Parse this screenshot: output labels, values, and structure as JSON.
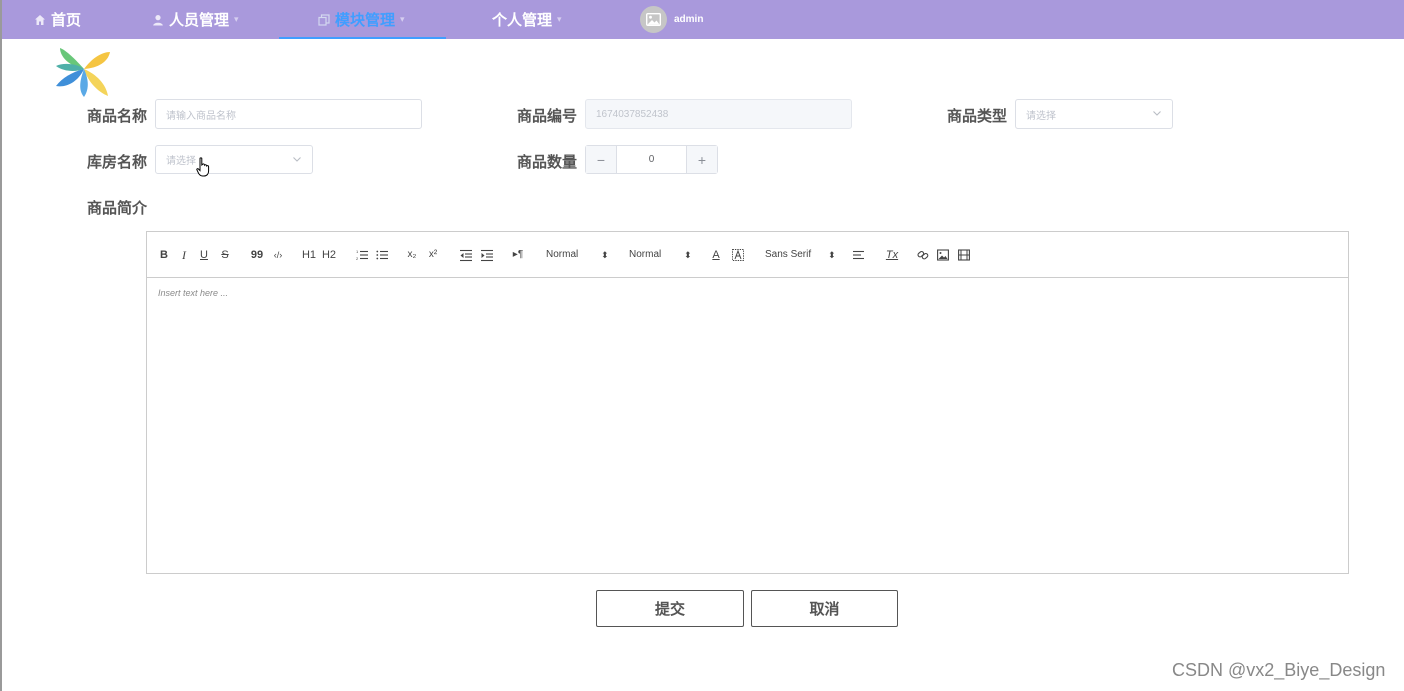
{
  "nav": {
    "items": [
      {
        "label": "首页",
        "icon": "home-icon"
      },
      {
        "label": "人员管理",
        "icon": "user-icon"
      },
      {
        "label": "模块管理",
        "icon": "copy-icon",
        "active": true
      },
      {
        "label": "个人管理"
      }
    ],
    "user": "admin"
  },
  "colors": {
    "nav_bg": "#a999dc",
    "accent": "#409eff"
  },
  "form": {
    "name_label": "商品名称",
    "name_placeholder": "请输入商品名称",
    "code_label": "商品编号",
    "code_value": "1674037852438",
    "type_label": "商品类型",
    "type_placeholder": "请选择",
    "warehouse_label": "库房名称",
    "warehouse_placeholder": "请选择",
    "qty_label": "商品数量",
    "qty_value": "0",
    "qty_minus": "−",
    "qty_plus": "+",
    "intro_label": "商品简介"
  },
  "editor": {
    "placeholder": "Insert text here ...",
    "toolbar": {
      "bold": "B",
      "italic": "I",
      "underline": "U",
      "strike": "S",
      "quote": "99",
      "code": "‹/›",
      "h1": "H1",
      "h2": "H2",
      "sub": "x₂",
      "sup": "x²",
      "rtl": "▸¶",
      "size": "Normal",
      "header": "Normal",
      "font_color": "A",
      "font": "Sans Serif",
      "clean": "Tx"
    }
  },
  "buttons": {
    "submit": "提交",
    "cancel": "取消"
  },
  "watermark": "CSDN @vx2_Biye_Design"
}
